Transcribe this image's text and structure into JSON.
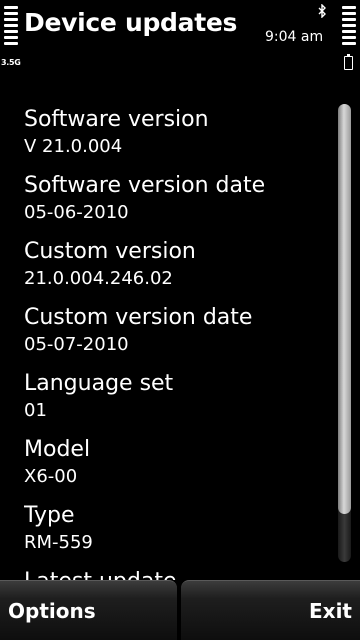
{
  "status": {
    "network_type": "3.5G",
    "time": "9:04 am",
    "bluetooth_icon": "bluetooth-icon"
  },
  "header": {
    "title": "Device updates"
  },
  "details": [
    {
      "label": "Software version",
      "value": "V 21.0.004"
    },
    {
      "label": "Software version date",
      "value": "05-06-2010"
    },
    {
      "label": "Custom version",
      "value": "21.0.004.246.02"
    },
    {
      "label": "Custom version date",
      "value": "05-07-2010"
    },
    {
      "label": "Language set",
      "value": "01"
    },
    {
      "label": "Model",
      "value": "X6-00"
    },
    {
      "label": "Type",
      "value": "RM-559"
    },
    {
      "label": "Latest update",
      "value": ""
    }
  ],
  "softkeys": {
    "left_label": "Options",
    "right_label": "Exit"
  }
}
